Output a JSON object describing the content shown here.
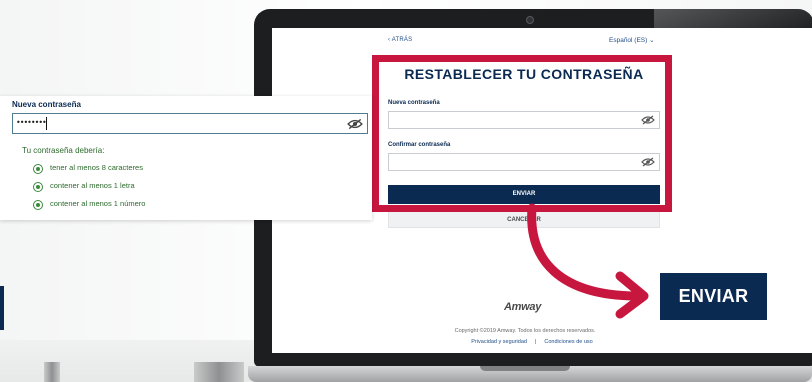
{
  "callout": {
    "label": "Nueva contraseña",
    "value": "••••••••",
    "rules_title": "Tu contraseña debería:",
    "rules": [
      "tener al menos 8 caracteres",
      "contener al menos 1 letra",
      "contener al menos 1 número"
    ]
  },
  "screen": {
    "back": "‹ ATRÁS",
    "language": "Español (ES) ⌄",
    "title": "RESTABLECER TU CONTRASEÑA",
    "field1_label": "Nueva contraseña",
    "field2_label": "Confirmar contraseña",
    "submit": "ENVIAR",
    "cancel": "CANCELAR",
    "brand": "Amway",
    "copyright": "Copyright ©2019 Amway. Todos los derechos reservados.",
    "privacy": "Privacidad y seguridad",
    "separator": "|",
    "terms": "Condiciones de uso"
  },
  "big_button": "ENVIAR",
  "colors": {
    "navy": "#0b2a52",
    "highlight_red": "#c8173f",
    "rule_green": "#3d8a3d"
  },
  "icons": [
    "eye-slash-icon",
    "radio-check-icon",
    "curved-arrow-icon",
    "chevron-down-icon"
  ]
}
